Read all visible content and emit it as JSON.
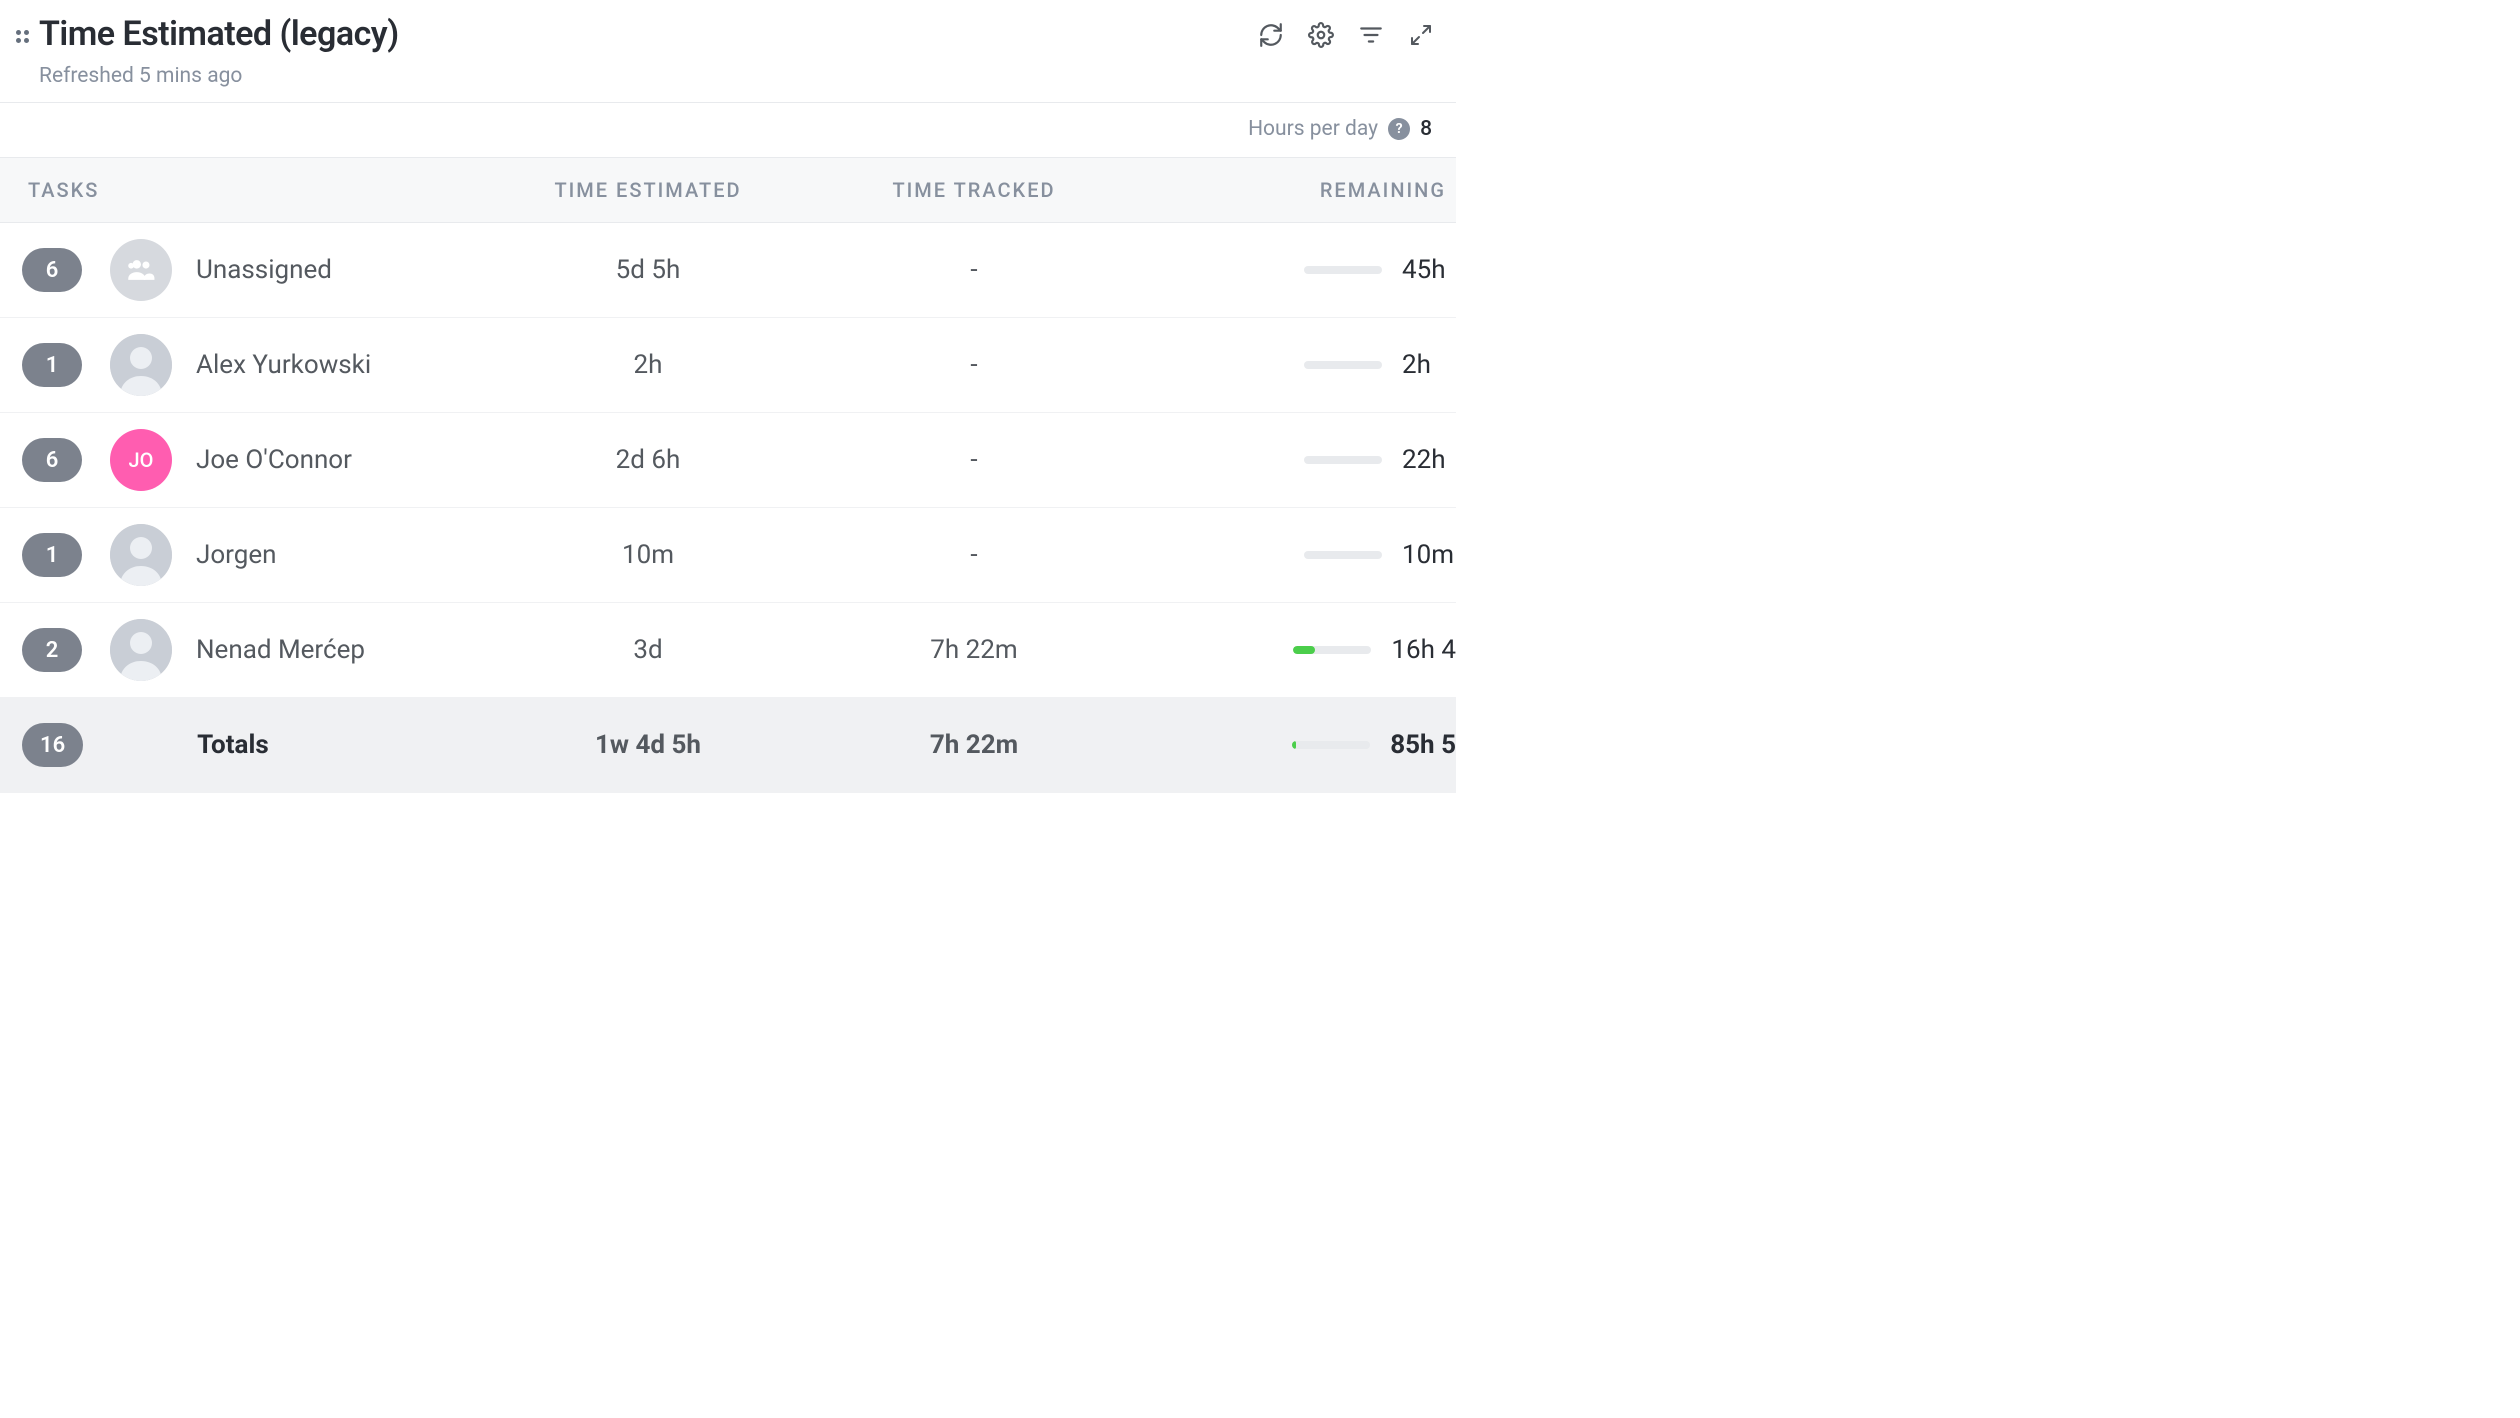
{
  "header": {
    "title": "Time Estimated (legacy)",
    "refreshed": "Refreshed 5 mins ago"
  },
  "hours_per_day": {
    "label": "Hours per day",
    "value": "8"
  },
  "columns": {
    "tasks": "TASKS",
    "estimated": "TIME ESTIMATED",
    "tracked": "TIME TRACKED",
    "remaining": "REMAINING"
  },
  "rows": [
    {
      "count": "6",
      "avatar_type": "group",
      "avatar_label": "",
      "name": "Unassigned",
      "estimated": "5d 5h",
      "tracked": "-",
      "progress_pct": 0,
      "remaining": "45h"
    },
    {
      "count": "1",
      "avatar_type": "photo",
      "avatar_label": "",
      "name": "Alex Yurkowski",
      "estimated": "2h",
      "tracked": "-",
      "progress_pct": 0,
      "remaining": "2h"
    },
    {
      "count": "6",
      "avatar_type": "jo",
      "avatar_label": "JO",
      "name": "Joe O'Connor",
      "estimated": "2d 6h",
      "tracked": "-",
      "progress_pct": 0,
      "remaining": "22h"
    },
    {
      "count": "1",
      "avatar_type": "photo",
      "avatar_label": "",
      "name": "Jorgen",
      "estimated": "10m",
      "tracked": "-",
      "progress_pct": 0,
      "remaining": "10m"
    },
    {
      "count": "2",
      "avatar_type": "photo",
      "avatar_label": "",
      "name": "Nenad Merćep",
      "estimated": "3d",
      "tracked": "7h 22m",
      "progress_pct": 28,
      "remaining": "16h 4"
    }
  ],
  "totals": {
    "count": "16",
    "name": "Totals",
    "estimated": "1w 4d 5h",
    "tracked": "7h 22m",
    "progress_pct": 5,
    "remaining": "85h 5"
  }
}
